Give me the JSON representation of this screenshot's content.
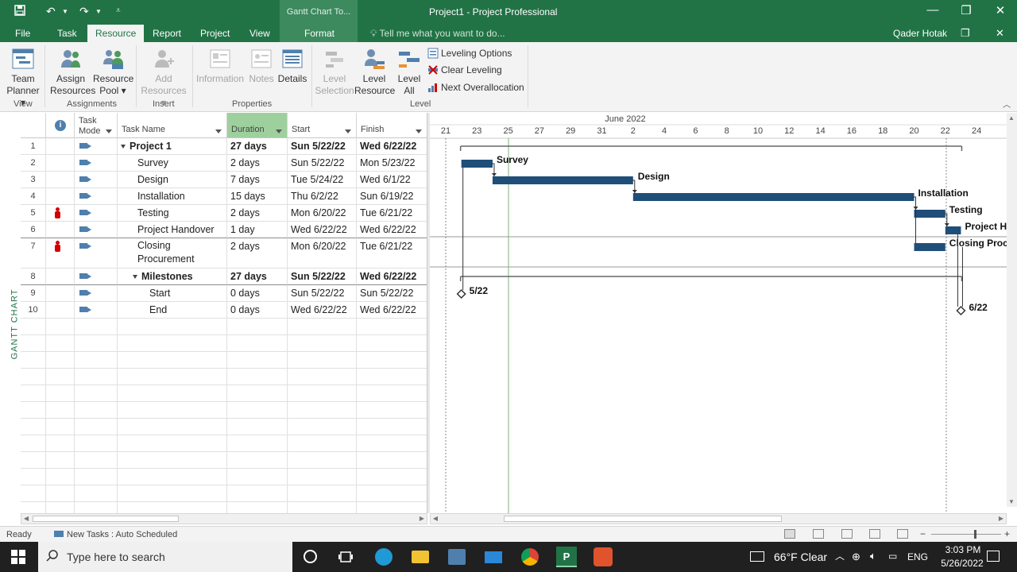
{
  "window": {
    "app_title": "Project1 - Project Professional",
    "context_title": "Gantt Chart To...",
    "user": "Qader Hotak"
  },
  "tabs": [
    "File",
    "Task",
    "Resource",
    "Report",
    "Project",
    "View",
    "Format"
  ],
  "tell_me": "Tell me what you want to do...",
  "ribbon": {
    "view": {
      "label": "View",
      "team_planner": [
        "Team",
        "Planner"
      ]
    },
    "assignments": {
      "label": "Assignments",
      "assign": [
        "Assign",
        "Resources"
      ],
      "pool": [
        "Resource",
        "Pool"
      ]
    },
    "insert": {
      "label": "Insert",
      "add": [
        "Add",
        "Resources"
      ]
    },
    "properties": {
      "label": "Properties",
      "information": "Information",
      "notes": "Notes",
      "details": "Details"
    },
    "level": {
      "label": "Level",
      "level_selection": [
        "Level",
        "Selection"
      ],
      "level_resource": [
        "Level",
        "Resource"
      ],
      "level_all": [
        "Level",
        "All"
      ],
      "leveling_options": "Leveling Options",
      "clear_leveling": "Clear Leveling",
      "next_overallocation": "Next Overallocation"
    }
  },
  "side_label": "GANTT CHART",
  "columns": {
    "task_mode": [
      "Task",
      "Mode"
    ],
    "task_name": "Task Name",
    "duration": "Duration",
    "start": "Start",
    "finish": "Finish"
  },
  "tasks": [
    {
      "id": "1",
      "name": "Project 1",
      "duration": "27 days",
      "start": "Sun 5/22/22",
      "finish": "Wed 6/22/22"
    },
    {
      "id": "2",
      "name": "Survey",
      "duration": "2 days",
      "start": "Sun 5/22/22",
      "finish": "Mon 5/23/22"
    },
    {
      "id": "3",
      "name": "Design",
      "duration": "7 days",
      "start": "Tue 5/24/22",
      "finish": "Wed 6/1/22"
    },
    {
      "id": "4",
      "name": "Installation",
      "duration": "15 days",
      "start": "Thu 6/2/22",
      "finish": "Sun 6/19/22"
    },
    {
      "id": "5",
      "name": "Testing",
      "duration": "2 days",
      "start": "Mon 6/20/22",
      "finish": "Tue 6/21/22"
    },
    {
      "id": "6",
      "name": "Project Handover",
      "duration": "1 day",
      "start": "Wed 6/22/22",
      "finish": "Wed 6/22/22"
    },
    {
      "id": "7",
      "name": "Closing",
      "name2": "Procurement",
      "duration": "2 days",
      "start": "Mon 6/20/22",
      "finish": "Tue 6/21/22"
    },
    {
      "id": "8",
      "name": "Milestones",
      "duration": "27 days",
      "start": "Sun 5/22/22",
      "finish": "Wed 6/22/22"
    },
    {
      "id": "9",
      "name": "Start",
      "duration": "0 days",
      "start": "Sun 5/22/22",
      "finish": "Sun 5/22/22"
    },
    {
      "id": "10",
      "name": "End",
      "duration": "0 days",
      "start": "Wed 6/22/22",
      "finish": "Wed 6/22/22"
    }
  ],
  "timescale": {
    "month": "June 2022",
    "days": [
      "21",
      "23",
      "25",
      "27",
      "29",
      "31",
      "2",
      "4",
      "6",
      "8",
      "10",
      "12",
      "14",
      "16",
      "18",
      "20",
      "22",
      "24"
    ]
  },
  "gantt_labels": {
    "survey": "Survey",
    "design": "Design",
    "installation": "Installation",
    "testing": "Testing",
    "handover": "Project Han",
    "closing": "Closing Procure",
    "start_ms": "5/22",
    "end_ms": "6/22"
  },
  "status": {
    "ready": "Ready",
    "new_tasks": "New Tasks : Auto Scheduled"
  },
  "taskbar": {
    "search": "Type here to search",
    "weather": "66°F  Clear",
    "lang": "ENG",
    "time": "3:03 PM",
    "date": "5/26/2022"
  },
  "colors": {
    "accent": "#217346",
    "bar": "#1f4e79",
    "indicator": "#d40000"
  }
}
